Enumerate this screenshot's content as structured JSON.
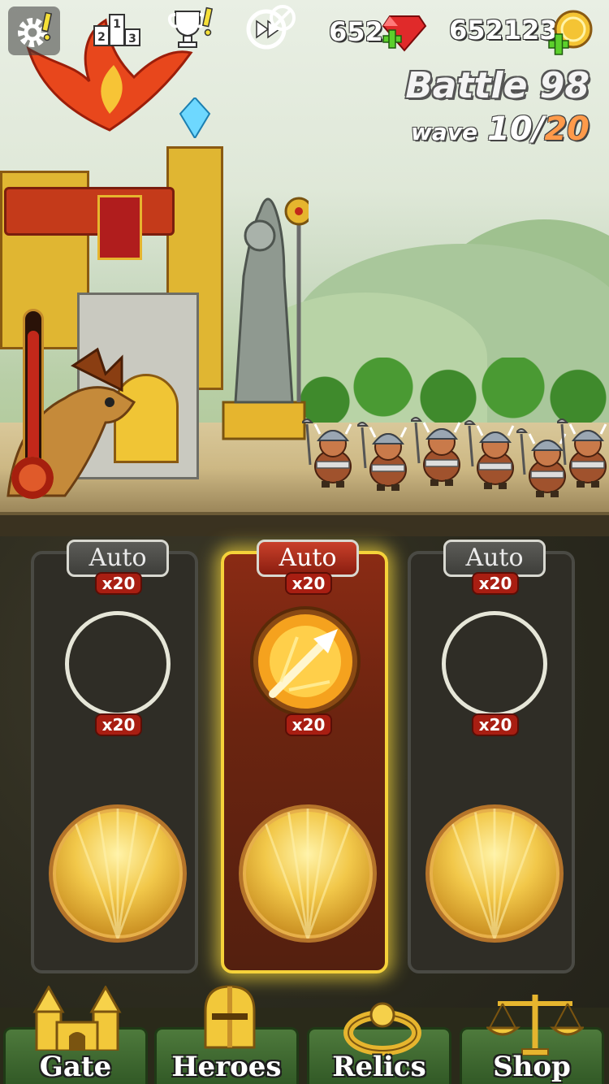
{
  "hud": {
    "settings_icon": "gear-icon",
    "leaderboard_icon": "podium-icon",
    "achievements_icon": "trophy-icon",
    "battle_speed_icon": "fast-forward-icon",
    "gems": "652",
    "coins": "652123"
  },
  "battle": {
    "title": "Battle 98",
    "wave_label": "wave",
    "wave_current": "10",
    "wave_separator": "/",
    "wave_total": "20",
    "gate_health_fraction": 0.9
  },
  "skills": [
    {
      "auto_label": "Auto",
      "count_top": "x20",
      "count_bottom": "x20",
      "icon": "empty-slot",
      "active": false
    },
    {
      "auto_label": "Auto",
      "count_top": "x20",
      "count_bottom": "x20",
      "icon": "spear-strike-icon",
      "active": true
    },
    {
      "auto_label": "Auto",
      "count_top": "x20",
      "count_bottom": "x20",
      "icon": "empty-slot",
      "active": false
    }
  ],
  "nav": {
    "gate": "Gate",
    "heroes": "Heroes",
    "relics": "Relics",
    "shop": "Shop"
  },
  "colors": {
    "active_glow": "#f5d23a",
    "wave_total": "#ff9a4a",
    "badge": "#a81e12",
    "nav_green": "#3f6a30"
  }
}
